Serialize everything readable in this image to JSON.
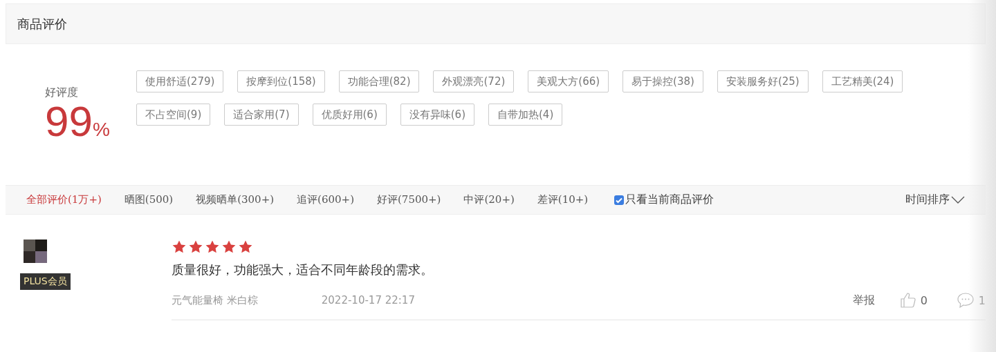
{
  "section_title": "商品评价",
  "rating": {
    "label": "好评度",
    "value": "99",
    "unit": "%"
  },
  "tags": [
    {
      "label": "使用舒适(279)"
    },
    {
      "label": "按摩到位(158)"
    },
    {
      "label": "功能合理(82)"
    },
    {
      "label": "外观漂亮(72)"
    },
    {
      "label": "美观大方(66)"
    },
    {
      "label": "易于操控(38)"
    },
    {
      "label": "安装服务好(25)"
    },
    {
      "label": "工艺精美(24)"
    },
    {
      "label": "不占空间(9)"
    },
    {
      "label": "适合家用(7)"
    },
    {
      "label": "优质好用(6)"
    },
    {
      "label": "没有异味(6)"
    },
    {
      "label": "自带加热(4)"
    }
  ],
  "filter_tabs": [
    {
      "label": "全部评价",
      "count": "(1万+)",
      "selected": true
    },
    {
      "label": "晒图",
      "count": "(500)",
      "selected": false
    },
    {
      "label": "视频晒单",
      "count": "(300+)",
      "selected": false
    },
    {
      "label": "追评",
      "count": "(600+)",
      "selected": false
    },
    {
      "label": "好评",
      "count": "(7500+)",
      "selected": false
    },
    {
      "label": "中评",
      "count": "(20+)",
      "selected": false
    },
    {
      "label": "差评",
      "count": "(10+)",
      "selected": false
    }
  ],
  "current_only": {
    "label": "只看当前商品评价",
    "checked": true
  },
  "sort": {
    "label": "时间排序"
  },
  "reviews": [
    {
      "badge": "PLUS会员",
      "stars": 5,
      "text": "质量很好，功能强大，适合不同年龄段的需求。",
      "variant": "元气能量椅 米白棕",
      "date": "2022-10-17 22:17",
      "report": "举报",
      "likes": "0",
      "replies": "1"
    }
  ]
}
